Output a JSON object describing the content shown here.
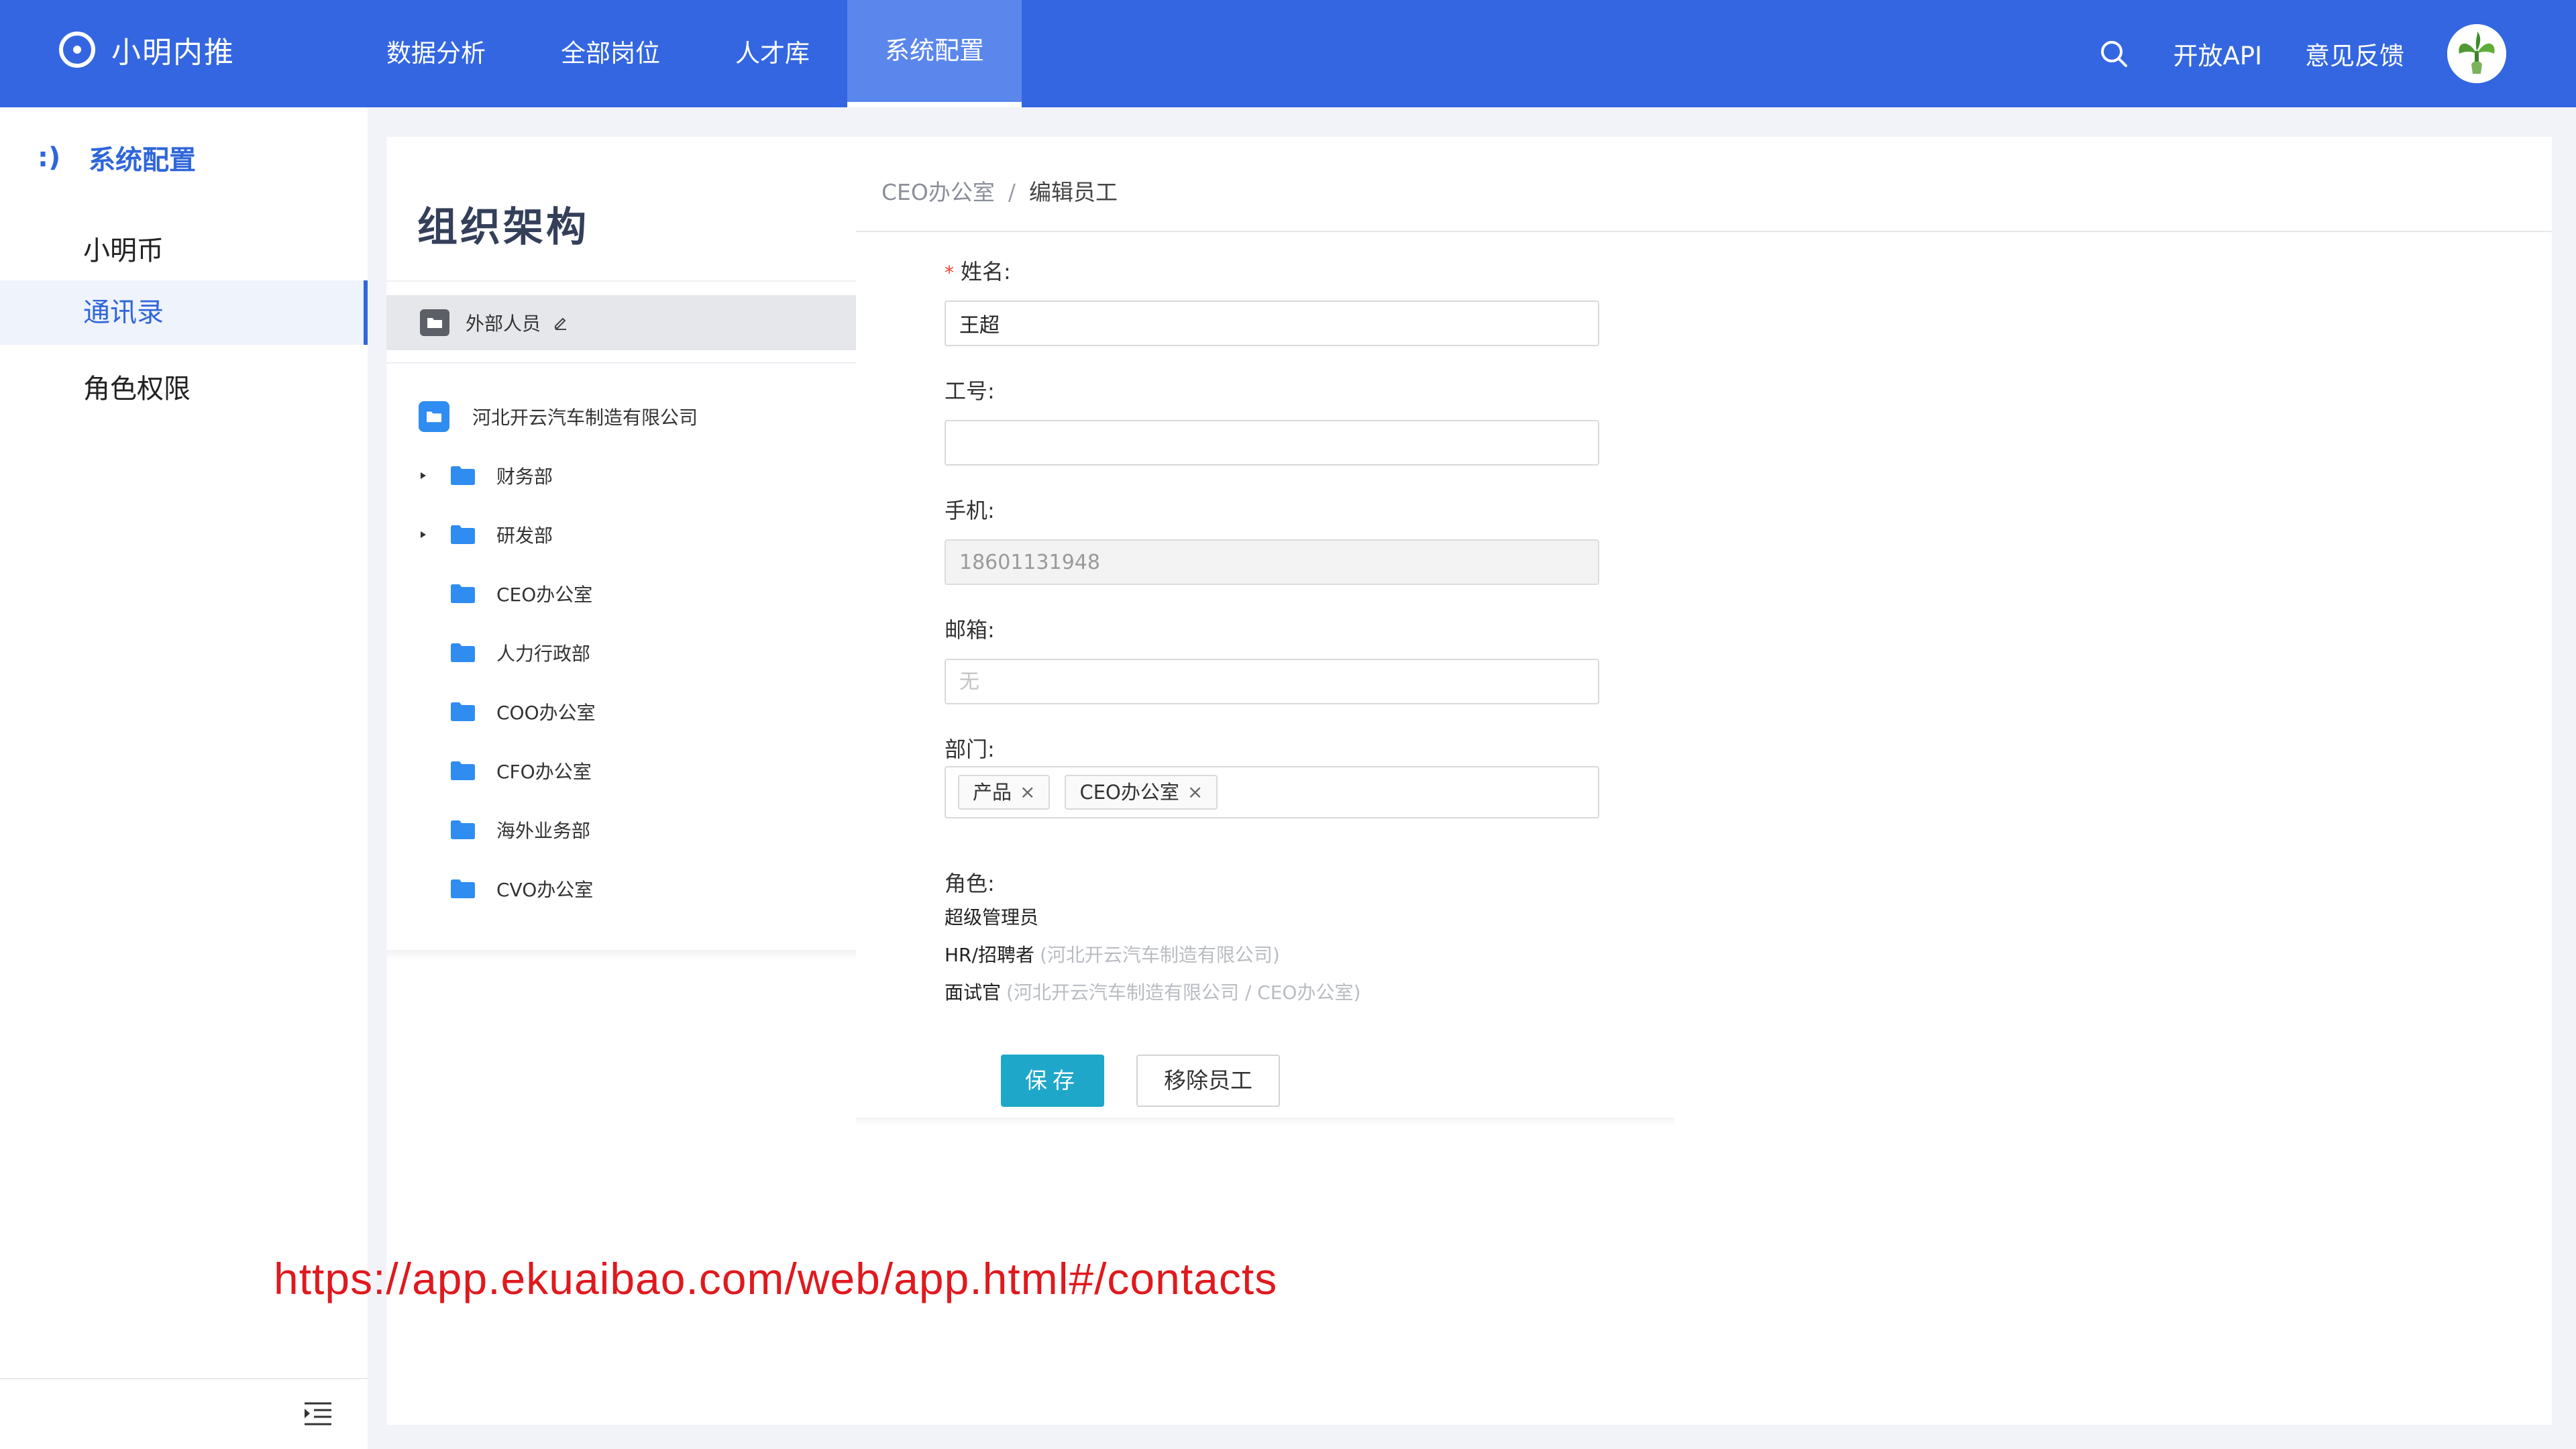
{
  "app": {
    "name": "小明内推"
  },
  "nav": {
    "items": [
      {
        "label": "数据分析"
      },
      {
        "label": "全部岗位"
      },
      {
        "label": "人才库"
      },
      {
        "label": "系统配置"
      }
    ],
    "active": "系统配置"
  },
  "header": {
    "open_api": "开放API",
    "feedback": "意见反馈"
  },
  "sidebar": {
    "title_icon": ":)",
    "title": "系统配置",
    "items": [
      {
        "label": "小明币"
      },
      {
        "label": "通讯录"
      },
      {
        "label": "角色权限"
      }
    ],
    "active": "通讯录"
  },
  "org": {
    "title": "组织架构",
    "external": "外部人员",
    "company": "河北开云汽车制造有限公司",
    "departments": [
      {
        "label": "财务部",
        "expandable": true
      },
      {
        "label": "研发部",
        "expandable": true
      },
      {
        "label": "CEO办公室",
        "expandable": false
      },
      {
        "label": "人力行政部",
        "expandable": false
      },
      {
        "label": "COO办公室",
        "expandable": false
      },
      {
        "label": "CFO办公室",
        "expandable": false
      },
      {
        "label": "海外业务部",
        "expandable": false
      },
      {
        "label": "CVO办公室",
        "expandable": false
      }
    ]
  },
  "breadcrumb": {
    "parent": "CEO办公室",
    "separator": "/",
    "current": "编辑员工"
  },
  "form": {
    "name_label": "姓名:",
    "name_required": "*",
    "name_value": "王超",
    "job_no_label": "工号:",
    "job_no_value": "",
    "phone_label": "手机:",
    "phone_value": "18601131948",
    "email_label": "邮箱:",
    "email_placeholder": "无",
    "dept_label": "部门:",
    "dept_tags": [
      {
        "label": "产品"
      },
      {
        "label": "CEO办公室"
      }
    ],
    "tag_close": "×",
    "role_label": "角色:",
    "roles": [
      {
        "name": "超级管理员",
        "scope": ""
      },
      {
        "name": "HR/招聘者",
        "scope": "(河北开云汽车制造有限公司)"
      },
      {
        "name": "面试官",
        "scope": "(河北开云汽车制造有限公司 / CEO办公室)"
      }
    ]
  },
  "actions": {
    "save": "保存",
    "remove": "移除员工"
  },
  "overlay": {
    "url": "https://app.ekuaibao.com/web/app.html#/contacts"
  },
  "colors": {
    "header": "#3366e0",
    "accent": "#2f66d9",
    "save": "#1fa7c9",
    "folder": "#2f8cf0",
    "url": "#e0191e"
  }
}
